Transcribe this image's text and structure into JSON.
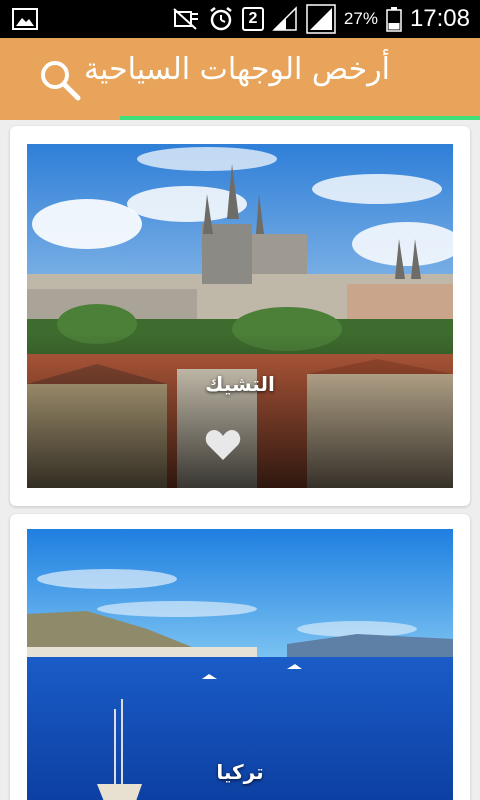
{
  "status_bar": {
    "battery_percent": "27%",
    "time": "17:08",
    "sim_slot": "2"
  },
  "app_bar": {
    "title": "أرخص الوجهات السياحية"
  },
  "destinations": [
    {
      "name": "التشيك"
    },
    {
      "name": "تركيا"
    }
  ]
}
